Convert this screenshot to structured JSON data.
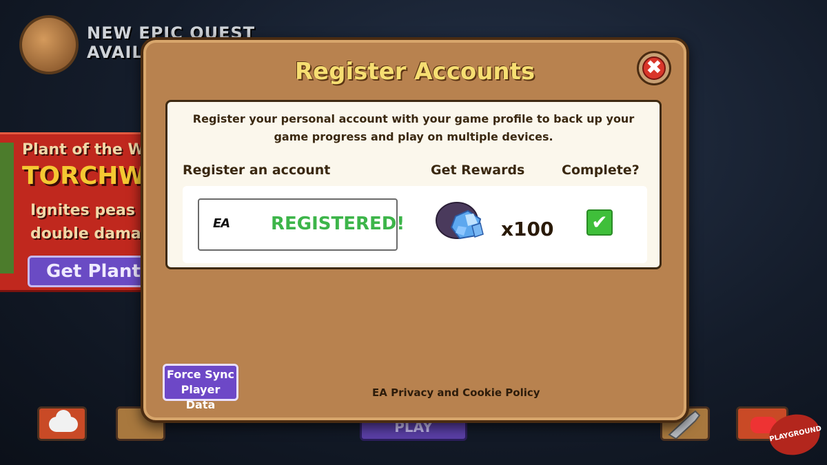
{
  "background": {
    "quest_banner": {
      "line1": "NEW EPIC QUEST",
      "line2": "AVAILA"
    },
    "plant_of_week": {
      "title": "Plant of the We",
      "name": "TORCHWOO",
      "desc_line1": "Ignites peas fo",
      "desc_line2": "double damage",
      "button_label": "Get Plant"
    },
    "play_label": "PLAY",
    "watermark": "PLAYGROUND"
  },
  "dialog": {
    "title": "Register Accounts",
    "close_glyph": "✖",
    "description": "Register your personal account with your game profile to back up your game progress and play on multiple devices.",
    "columns": {
      "account": "Register an account",
      "rewards": "Get Rewards",
      "complete": "Complete?"
    },
    "row": {
      "provider_logo": "EA",
      "status": "REGISTERED!",
      "reward_icon": "gem-pouch-icon",
      "reward_count": "x100",
      "check_glyph": "✔"
    },
    "force_sync_line1": "Force Sync",
    "force_sync_line2": "Player Data",
    "privacy_link": "EA Privacy and Cookie Policy"
  },
  "colors": {
    "dialog_bg": "#b8824f",
    "title": "#f6de72",
    "registered_green": "#3db54a",
    "force_sync_purple": "#6d48c7",
    "close_red": "#d9362a"
  }
}
